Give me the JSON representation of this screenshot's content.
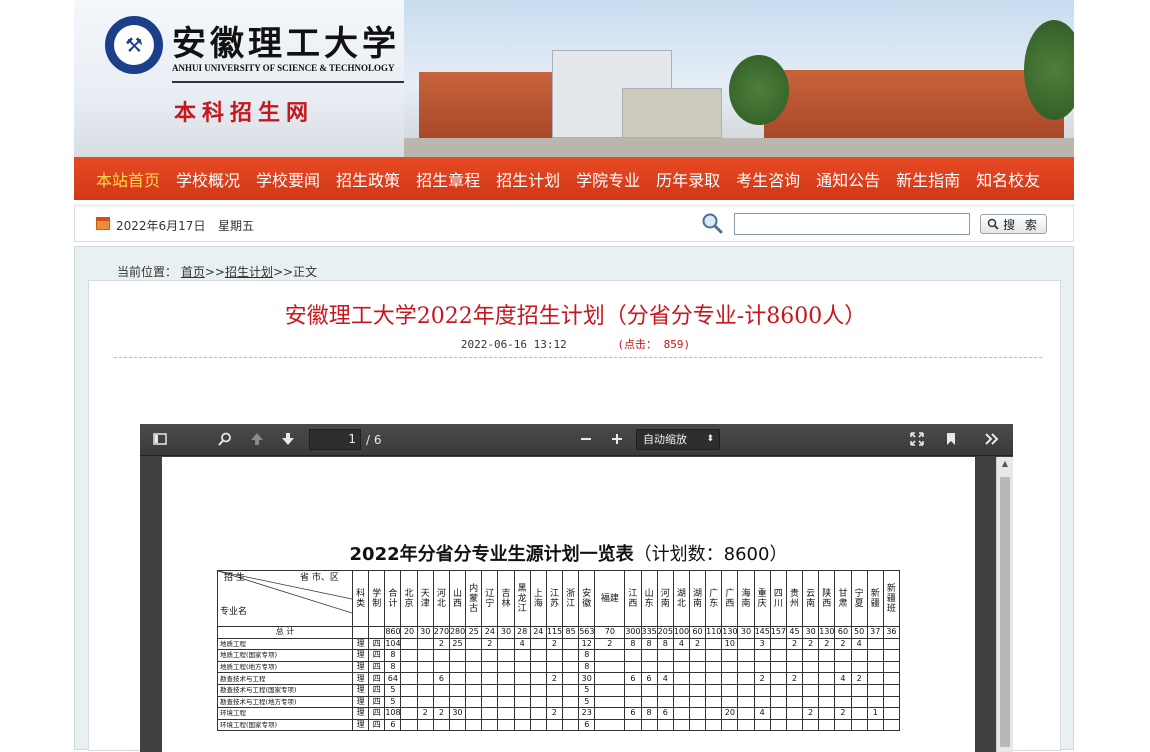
{
  "header": {
    "school_name_cn": "安徽理工大学",
    "school_name_en": "ANHUI UNIVERSITY OF SCIENCE & TECHNOLOGY",
    "site_name": "本科招生网"
  },
  "nav": {
    "items": [
      {
        "label": "本站首页",
        "active": true
      },
      {
        "label": "学校概况"
      },
      {
        "label": "学校要闻"
      },
      {
        "label": "招生政策"
      },
      {
        "label": "招生章程"
      },
      {
        "label": "招生计划"
      },
      {
        "label": "学院专业"
      },
      {
        "label": "历年录取"
      },
      {
        "label": "考生咨询"
      },
      {
        "label": "通知公告"
      },
      {
        "label": "新生指南"
      },
      {
        "label": "知名校友"
      }
    ]
  },
  "topbar": {
    "date": "2022年6月17日",
    "weekday": "星期五",
    "search_value": "",
    "search_button": "搜 索"
  },
  "breadcrumb": {
    "prefix": "当前位置：",
    "home": "首页",
    "sep1": ">>",
    "section": "招生计划",
    "sep2": ">>",
    "current": "正文"
  },
  "article": {
    "title": "安徽理工大学2022年度招生计划（分省分专业-计8600人）",
    "datetime": "2022-06-16 13:12",
    "hits": "(点击： 859)"
  },
  "pdf_viewer": {
    "current_page": "1",
    "page_total": "/ 6",
    "zoom": "自动缩放",
    "doc_title_main": "2022年分省分专业生源计划一览表",
    "doc_title_paren": "（计划数：8600）",
    "table": {
      "corner": {
        "c1": "招 生",
        "c2": "省 市、区",
        "c3": "专业名"
      },
      "headers": [
        "科类",
        "学制",
        "合计",
        "北京",
        "天津",
        "河北",
        "山西",
        "内蒙古",
        "辽宁",
        "吉林",
        "黑龙江",
        "上海",
        "江苏",
        "浙江",
        "安徽",
        "福建",
        "江西",
        "山东",
        "河南",
        "湖北",
        "湖南",
        "广东",
        "广西",
        "海南",
        "重庆",
        "四川",
        "贵州",
        "云南",
        "陕西",
        "甘肃",
        "宁夏",
        "新疆",
        "新疆班"
      ],
      "total_label": "总 计",
      "total_row": [
        "",
        "",
        "8600",
        "20",
        "30",
        "270",
        "280",
        "25",
        "24",
        "30",
        "28",
        "24",
        "115",
        "85",
        "5639",
        "70",
        "300",
        "335",
        "205",
        "100",
        "60",
        "110",
        "130",
        "30",
        "145",
        "157",
        "45",
        "30",
        "130",
        "60",
        "50",
        "37",
        "36"
      ],
      "rows": [
        {
          "name": "地质工程",
          "cells": [
            "理",
            "四",
            "104",
            "",
            "",
            "2",
            "25",
            "",
            "2",
            "",
            "4",
            "",
            "2",
            "",
            "12",
            "2",
            "8",
            "8",
            "8",
            "4",
            "2",
            "",
            "10",
            "",
            "3",
            "",
            "2",
            "2",
            "2",
            "2",
            "4",
            "",
            ""
          ]
        },
        {
          "name": "地质工程(国家专项)",
          "cells": [
            "理",
            "四",
            "8",
            "",
            "",
            "",
            "",
            "",
            "",
            "",
            "",
            "",
            "",
            "",
            "8",
            "",
            "",
            "",
            "",
            "",
            "",
            "",
            "",
            "",
            "",
            "",
            "",
            "",
            "",
            "",
            "",
            "",
            ""
          ]
        },
        {
          "name": "地质工程(地方专项)",
          "cells": [
            "理",
            "四",
            "8",
            "",
            "",
            "",
            "",
            "",
            "",
            "",
            "",
            "",
            "",
            "",
            "8",
            "",
            "",
            "",
            "",
            "",
            "",
            "",
            "",
            "",
            "",
            "",
            "",
            "",
            "",
            "",
            "",
            "",
            ""
          ]
        },
        {
          "name": "勘查技术与工程",
          "cells": [
            "理",
            "四",
            "64",
            "",
            "",
            "6",
            "",
            "",
            "",
            "",
            "",
            "",
            "2",
            "",
            "30",
            "",
            "6",
            "6",
            "4",
            "",
            "",
            "",
            "",
            "",
            "2",
            "",
            "2",
            "",
            "",
            "4",
            "2",
            "",
            ""
          ]
        },
        {
          "name": "勘查技术与工程(国家专项)",
          "cells": [
            "理",
            "四",
            "5",
            "",
            "",
            "",
            "",
            "",
            "",
            "",
            "",
            "",
            "",
            "",
            "5",
            "",
            "",
            "",
            "",
            "",
            "",
            "",
            "",
            "",
            "",
            "",
            "",
            "",
            "",
            "",
            "",
            "",
            ""
          ]
        },
        {
          "name": "勘查技术与工程(地方专项)",
          "cells": [
            "理",
            "四",
            "5",
            "",
            "",
            "",
            "",
            "",
            "",
            "",
            "",
            "",
            "",
            "",
            "5",
            "",
            "",
            "",
            "",
            "",
            "",
            "",
            "",
            "",
            "",
            "",
            "",
            "",
            "",
            "",
            "",
            "",
            ""
          ]
        },
        {
          "name": "环境工程",
          "cells": [
            "理",
            "四",
            "108",
            "",
            "2",
            "2",
            "30",
            "",
            "",
            "",
            "",
            "",
            "2",
            "",
            "23",
            "",
            "6",
            "8",
            "6",
            "",
            "",
            "",
            "20",
            "",
            "4",
            "",
            "",
            "2",
            "",
            "2",
            "",
            "1",
            ""
          ]
        },
        {
          "name": "环境工程(国家专项)",
          "cells": [
            "理",
            "四",
            "6",
            "",
            "",
            "",
            "",
            "",
            "",
            "",
            "",
            "",
            "",
            "",
            "6",
            "",
            "",
            "",
            "",
            "",
            "",
            "",
            "",
            "",
            "",
            "",
            "",
            "",
            "",
            "",
            "",
            "",
            ""
          ]
        }
      ]
    }
  },
  "colors": {
    "nav_bg": "#d23717",
    "nav_active": "#ffd94a",
    "title_red": "#c8161d",
    "content_bg": "#e9f0f2"
  }
}
